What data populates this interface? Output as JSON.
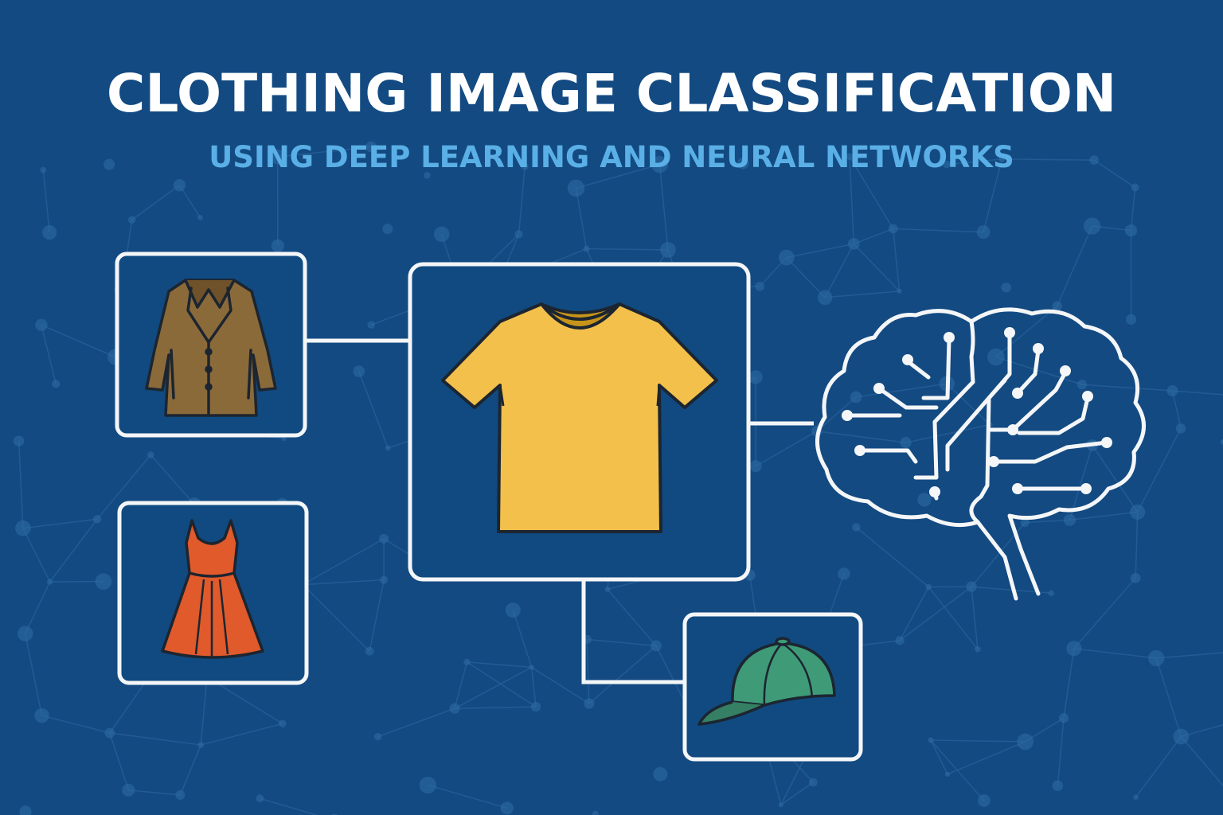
{
  "title": "CLOTHING IMAGE CLASSIFICATION",
  "subtitle": "USING DEEP LEARNING AND NEURAL NETWORKS",
  "colors": {
    "background": "#134a82",
    "box_fill": "#104a80",
    "line": "#f4f6f8",
    "subtitle": "#5ab0e6",
    "coat": "#8b6a3a",
    "dress": "#e05a2b",
    "tshirt": "#f2c04b",
    "cap": "#3f9a78"
  },
  "nodes": [
    {
      "id": "coat",
      "icon": "coat-icon"
    },
    {
      "id": "dress",
      "icon": "dress-icon"
    },
    {
      "id": "tshirt",
      "icon": "tshirt-icon"
    },
    {
      "id": "cap",
      "icon": "cap-icon"
    },
    {
      "id": "brain",
      "icon": "brain-circuit-icon"
    }
  ]
}
